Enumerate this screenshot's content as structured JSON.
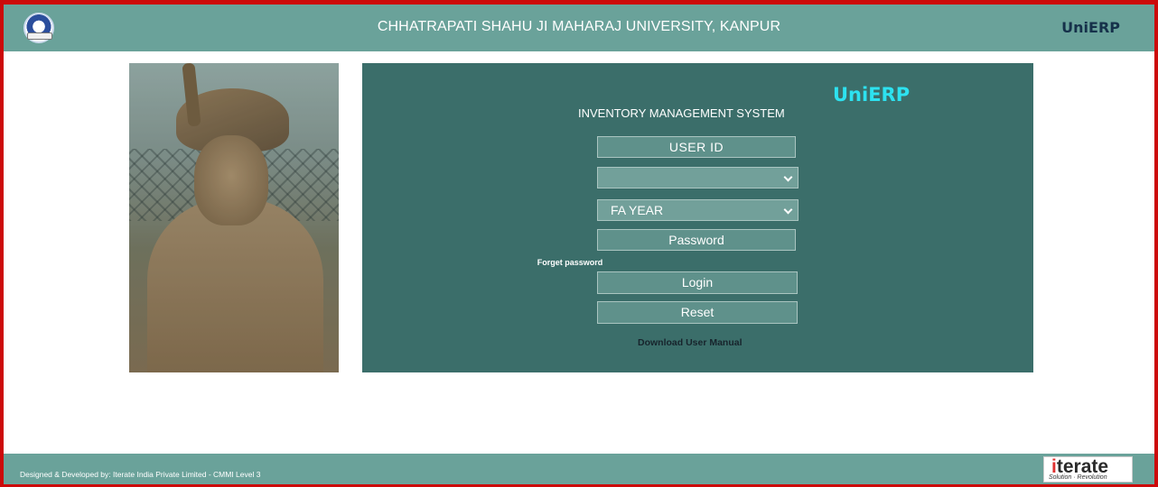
{
  "header": {
    "title": "CHHATRAPATI SHAHU JI MAHARAJ UNIVERSITY, KANPUR",
    "brand": "UniERP",
    "logo_icon": "university-seal-icon"
  },
  "photo": {
    "subject": "statue-photo"
  },
  "login": {
    "brand": "UniERP",
    "system_title": "INVENTORY MANAGEMENT SYSTEM",
    "user_id_label": "USER ID",
    "unit_select_value": "",
    "fa_year_value": "FA YEAR",
    "password_placeholder": "Password",
    "forget_password": "Forget password",
    "login_button": "Login",
    "reset_button": "Reset",
    "download_manual": "Download User Manual"
  },
  "footer": {
    "credit": "Designed & Developed by: Iterate India Private Limited - CMMI Level 3",
    "logo_word_first": "i",
    "logo_word_rest": "terate",
    "logo_tagline": "Solution · Revolution"
  },
  "colors": {
    "frame": "#cc0a0a",
    "header_bg": "#6aa29a",
    "panel_bg": "#3b6e6a",
    "brand_accent": "#2de2f0"
  }
}
